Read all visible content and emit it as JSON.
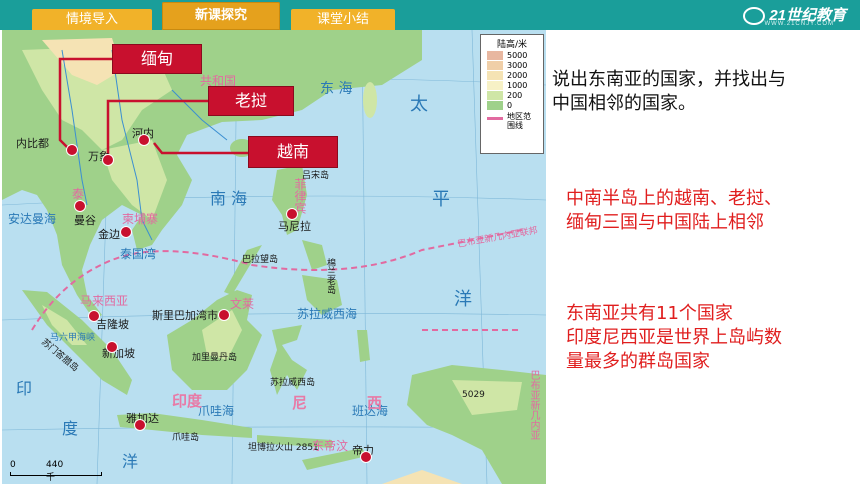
{
  "nav": {
    "tabs": [
      {
        "label": "情境导入"
      },
      {
        "label": "新课探究"
      },
      {
        "label": "课堂小结"
      }
    ],
    "logo": "21世纪教育",
    "logo_sub": "WWW.21CNJY.COM"
  },
  "map": {
    "legend": {
      "title": "陆高/米",
      "levels": [
        "5000",
        "3000",
        "2000",
        "1000",
        "200",
        "0"
      ],
      "colors": [
        "#e8b7a0",
        "#f0cfa8",
        "#f5e3b4",
        "#f7f1c6",
        "#cfe6a6",
        "#9fd18a"
      ],
      "boundary_label": "地区范围线"
    },
    "scale": {
      "start": "0",
      "end": "440千米"
    },
    "callouts": {
      "myanmar": "缅甸",
      "laos": "老挝",
      "vietnam": "越南"
    },
    "labels": {
      "east_sea": "东  海",
      "south_china_sea": "南     海",
      "pacific_1": "太",
      "pacific_2": "平",
      "pacific_3": "洋",
      "indian_1": "印",
      "indian_2": "度",
      "indian_3": "洋",
      "china": "共和国",
      "nepyidaw": "内比都",
      "hanoi": "河内",
      "vientiane": "万象",
      "bangkok": "曼谷",
      "phnom_penh": "金边",
      "thailand": "泰",
      "cambodia": "柬埔寨",
      "philippines": "菲律宾",
      "manila": "马尼拉",
      "luzon": "吕宋岛",
      "malaysia": "马来西亚",
      "kuala_lumpur": "吉隆坡",
      "singapore": "新加坡",
      "brunei": "文莱",
      "bandar": "斯里巴加湾市",
      "kalimantan": "加里曼丹岛",
      "sumatra": "苏门答腊岛",
      "jakarta": "雅加达",
      "java": "爪哇岛",
      "timor_leste": "东帝汶",
      "dili": "帝力",
      "indonesia_1": "印度",
      "indonesia_2": "尼",
      "indonesia_3": "西",
      "papua": "巴布亚新几内亚",
      "papua_dashed": "巴布亚新几内亚联邦",
      "sulawesi": "苏拉威西岛",
      "mindanao": "棉兰老岛",
      "palawan": "巴拉望岛",
      "andaman": "安达曼海",
      "gulf_thailand": "泰国湾",
      "java_sea": "爪哇海",
      "banda": "班达海",
      "celebes": "苏拉威西海",
      "timor_peak": "坦博拉火山 2851",
      "papua_peak": "5029",
      "malacca": "马六甲海峡"
    }
  },
  "text": {
    "question": [
      "说出东南亚的国家，并找出与",
      "中国相邻的国家。"
    ],
    "answer1": [
      "中南半岛上的越南、老挝、",
      "缅甸三国与中国陆上相邻"
    ],
    "answer2": [
      "东南亚共有11个国家",
      "印度尼西亚是世界上岛屿数",
      "量最多的群岛国家"
    ]
  }
}
